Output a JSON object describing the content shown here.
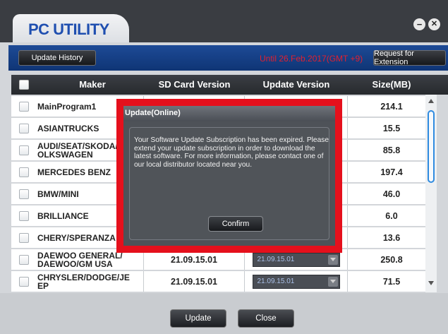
{
  "window": {
    "title": "PC UTILITY",
    "minimize_glyph": "−",
    "close_glyph": "✕"
  },
  "toolbar": {
    "history_label": "Update History",
    "until_text": "Until 26.Feb.2017(GMT +9)",
    "extension_label": "Request for Extension"
  },
  "table": {
    "columns": [
      "Maker",
      "SD Card Version",
      "Update Version",
      "Size(MB)"
    ],
    "rows": [
      {
        "maker": "MainProgram1",
        "sd": "",
        "update": "",
        "size": "214.1"
      },
      {
        "maker": "ASIANTRUCKS",
        "sd": "",
        "update": "",
        "size": "15.5"
      },
      {
        "maker": "AUDI/SEAT/SKODA/V\nOLKSWAGEN",
        "sd": "",
        "update": "",
        "size": "85.8"
      },
      {
        "maker": "MERCEDES BENZ",
        "sd": "",
        "update": "",
        "size": "197.4"
      },
      {
        "maker": "BMW/MINI",
        "sd": "",
        "update": "",
        "size": "46.0"
      },
      {
        "maker": "BRILLIANCE",
        "sd": "",
        "update": "",
        "size": "6.0"
      },
      {
        "maker": "CHERY/SPERANZA",
        "sd": "",
        "update": "",
        "size": "13.6"
      },
      {
        "maker": "DAEWOO GENERAL/\nDAEWOO/GM USA",
        "sd": "21.09.15.01",
        "update": "21.09.15.01",
        "size": "250.8"
      },
      {
        "maker": "CHRYSLER/DODGE/JE\nEP",
        "sd": "21.09.15.01",
        "update": "21.09.15.01",
        "size": "71.5"
      }
    ]
  },
  "footer": {
    "update_label": "Update",
    "close_label": "Close"
  },
  "dialog": {
    "title": "Update(Online)",
    "message": "Your Software Update Subscription has been expired. Please extend your update subscription in order to download the latest software. For more information, please contact one of our local distributor located near you.",
    "confirm_label": "Confirm"
  },
  "colors": {
    "accent_blue": "#1f4fb0",
    "toolbar_blue": "#0f3575",
    "expiry_red": "#e02030",
    "highlight_red": "#e5101c"
  }
}
